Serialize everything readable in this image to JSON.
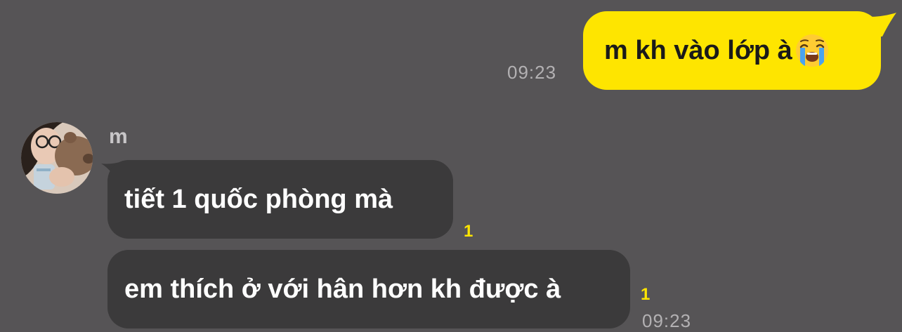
{
  "chat": {
    "outgoing": {
      "text": "m kh vào lớp à",
      "emoji": "loudly-crying-face-emoji",
      "time": "09:23"
    },
    "incoming": {
      "sender": "m",
      "avatar": "profile-photo-avatar",
      "messages": [
        {
          "text": "tiết 1 quốc phòng mà",
          "unread": "1"
        },
        {
          "text": "em thích ở với hân hơn kh được à",
          "unread": "1"
        }
      ],
      "time": "09:23"
    }
  },
  "colors": {
    "background": "#565456",
    "outgoing_bubble": "#FEE500",
    "incoming_bubble": "#3b3a3b",
    "unread_count": "#FEE500",
    "timestamp": "#b3b1b3"
  }
}
